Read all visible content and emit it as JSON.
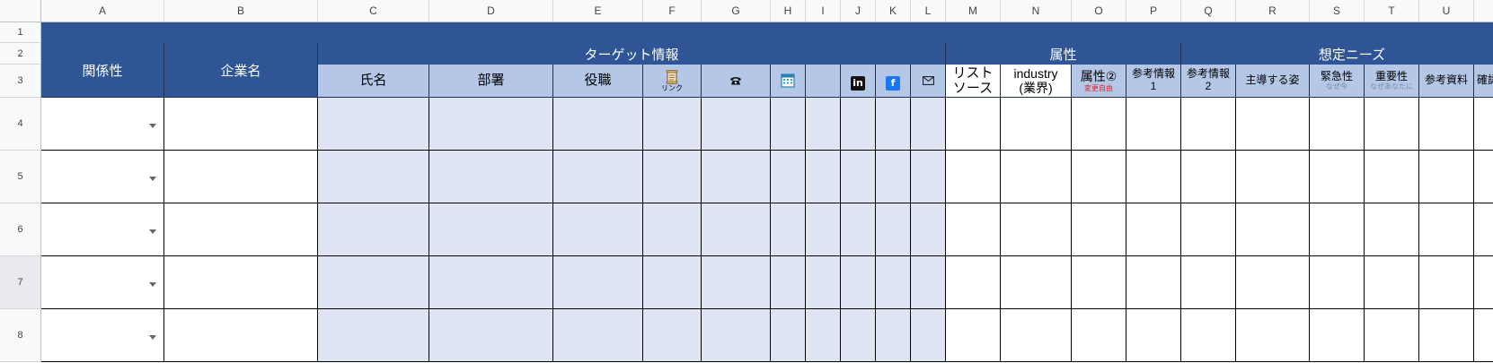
{
  "columns": [
    "A",
    "B",
    "C",
    "D",
    "E",
    "F",
    "G",
    "H",
    "I",
    "J",
    "K",
    "L",
    "M",
    "N",
    "O",
    "P",
    "Q",
    "R",
    "S",
    "T",
    "U"
  ],
  "rows": [
    "1",
    "2",
    "3",
    "4",
    "5",
    "6",
    "7",
    "8"
  ],
  "colors": {
    "navy": "#2f5597",
    "subheader": "#b4c7e7",
    "input_blue": "#dfe4f3",
    "facebook": "#1877f2",
    "linkedin": "#111111",
    "note_red": "#e02020"
  },
  "headers": {
    "relation": "関係性",
    "company": "企業名",
    "target_info": "ターゲット情報",
    "attributes": "属性",
    "expected_needs": "想定ニーズ"
  },
  "subheaders": {
    "name": "氏名",
    "department": "部署",
    "position": "役職",
    "link": "リンク",
    "list_source_1": "リスト",
    "list_source_2": "ソース",
    "industry_1": "industry",
    "industry_2": "(業界)",
    "attribute2": "属性②",
    "attribute2_note": "変更自由",
    "ref1_1": "参考情報",
    "ref1_2": "1",
    "ref2_1": "参考情報",
    "ref2_2": "2",
    "leading_figure": "主導する姿",
    "urgency": "緊急性",
    "urgency_note": "なぜ今",
    "importance": "重要性",
    "importance_note": "なぜあなたに",
    "reference_material": "参考資料",
    "confirmation_items": "確認事項"
  },
  "icons": {
    "link": "scroll-icon",
    "phone": "phone-icon",
    "calendar": "calendar-icon",
    "linkedin": "linkedin-icon",
    "facebook": "facebook-icon",
    "email": "envelope-icon"
  }
}
